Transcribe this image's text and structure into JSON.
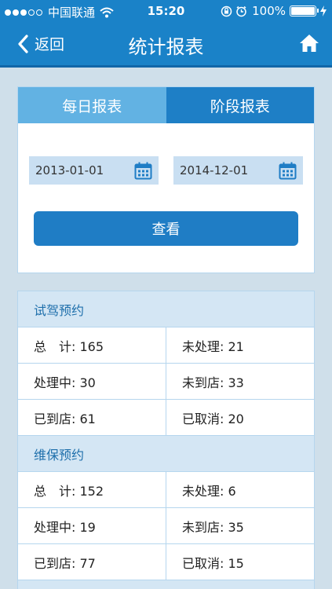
{
  "status_bar": {
    "carrier": "中国联通",
    "time": "15:20",
    "battery": "100%",
    "signal_dots_full": 3,
    "signal_dots_empty": 2
  },
  "nav": {
    "back_label": "返回",
    "title": "统计报表",
    "home_icon": "home-icon"
  },
  "tabs": {
    "daily": "每日报表",
    "period": "阶段报表",
    "active": "period"
  },
  "dates": {
    "start": "2013-01-01",
    "end": "2014-12-01"
  },
  "view_button": "查看",
  "sections": [
    {
      "title": "试驾预约",
      "rows": [
        [
          "总　计: 165",
          "未处理: 21"
        ],
        [
          "处理中: 30",
          "未到店: 33"
        ],
        [
          "已到店: 61",
          "已取消: 20"
        ]
      ]
    },
    {
      "title": "维保预约",
      "rows": [
        [
          "总　计: 152",
          "未处理: 6"
        ],
        [
          "处理中: 19",
          "未到店: 35"
        ],
        [
          "已到店: 77",
          "已取消: 15"
        ]
      ]
    }
  ],
  "colors": {
    "primary": "#1a82c8",
    "tab_inactive": "#62b2e3",
    "section_header": "#d4e6f4",
    "background": "#cfdfea"
  }
}
